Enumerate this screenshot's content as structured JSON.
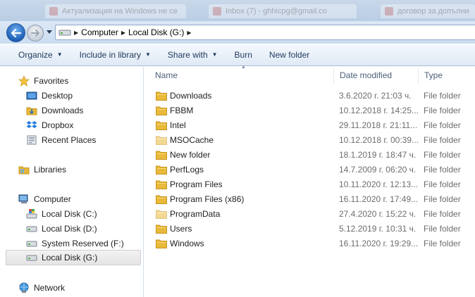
{
  "colors": {
    "folder": "#e8b93a",
    "folder_dark": "#c8951e",
    "link_text": "#1e395b"
  },
  "tabs": [
    "Актуализация на Windows не се",
    "Inbox (7) - ghhicpg@gmail.co",
    "договор за допълни"
  ],
  "address": {
    "crumbs": [
      "Computer",
      "Local Disk (G:)"
    ]
  },
  "toolbar": {
    "organize": "Organize",
    "include_in_library": "Include in library",
    "share_with": "Share with",
    "burn": "Burn",
    "new_folder": "New folder"
  },
  "nav": {
    "favorites": "Favorites",
    "desktop": "Desktop",
    "downloads": "Downloads",
    "dropbox": "Dropbox",
    "recent_places": "Recent Places",
    "libraries": "Libraries",
    "computer": "Computer",
    "drive_c": "Local Disk (C:)",
    "drive_d": "Local Disk (D:)",
    "drive_f": "System Reserved (F:)",
    "drive_g": "Local Disk (G:)",
    "network": "Network"
  },
  "columns": {
    "name": "Name",
    "date_modified": "Date modified",
    "type": "Type"
  },
  "files": [
    {
      "name": "Downloads",
      "date": "3.6.2020 г. 21:03 ч.",
      "type": "File folder",
      "faded": false
    },
    {
      "name": "FBBM",
      "date": "10.12.2018 г. 14:25...",
      "type": "File folder",
      "faded": false
    },
    {
      "name": "Intel",
      "date": "29.11.2018 г. 21:11...",
      "type": "File folder",
      "faded": false
    },
    {
      "name": "MSOCache",
      "date": "10.12.2018 г. 00:39...",
      "type": "File folder",
      "faded": true
    },
    {
      "name": "New folder",
      "date": "18.1.2019 г. 18:47 ч.",
      "type": "File folder",
      "faded": false
    },
    {
      "name": "PerfLogs",
      "date": "14.7.2009 г. 06:20 ч.",
      "type": "File folder",
      "faded": false
    },
    {
      "name": "Program Files",
      "date": "10.11.2020 г. 12:13...",
      "type": "File folder",
      "faded": false
    },
    {
      "name": "Program Files (x86)",
      "date": "16.11.2020 г. 17:49...",
      "type": "File folder",
      "faded": false
    },
    {
      "name": "ProgramData",
      "date": "27.4.2020 г. 15:22 ч.",
      "type": "File folder",
      "faded": true
    },
    {
      "name": "Users",
      "date": "5.12.2019 г. 10:31 ч.",
      "type": "File folder",
      "faded": false
    },
    {
      "name": "Windows",
      "date": "16.11.2020 г. 19:29...",
      "type": "File folder",
      "faded": false
    }
  ]
}
